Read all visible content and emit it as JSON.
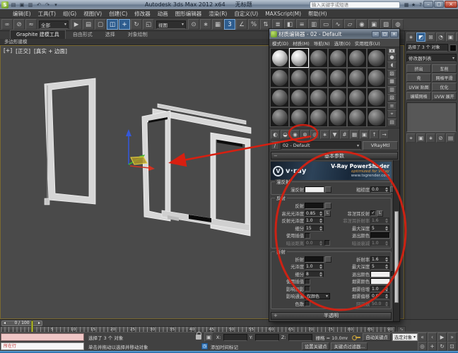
{
  "colors": {
    "annotation_red": "#d81f10",
    "vray_banner_blue": "#1e3146",
    "vray_orange": "#e29a3c",
    "toolbar_highlight_blue": "#2e5d8f",
    "active_viewport_yellow": "#7a6930",
    "diffuse_swatch": "#f0f0f0",
    "reflect_swatch": "#141414",
    "time_cursor_yellow": "#c9d435"
  },
  "titlebar": {
    "app_title": "Autodesk 3ds Max 2012 x64",
    "doc_title": "无标题",
    "search_placeholder": "输入关键字或短语",
    "window_controls": {
      "minimize": "–",
      "maximize": "▢",
      "close": "×"
    }
  },
  "menubar": {
    "items": [
      "编辑(E)",
      "工具(T)",
      "组(G)",
      "视图(V)",
      "创建(C)",
      "修改器",
      "动画",
      "图形编辑器",
      "渲染(R)",
      "自定义(U)",
      "MAXScript(M)",
      "帮助(H)"
    ]
  },
  "toolbar": {
    "icons": [
      {
        "name": "select-and-link-icon",
        "glyph": "∞"
      },
      {
        "name": "unlink-selection-icon",
        "glyph": "⊘"
      },
      {
        "name": "bind-to-space-warp-icon",
        "glyph": "≈"
      },
      {
        "name": "selection-filter-dropdown",
        "type": "dropdown",
        "label": "全部"
      },
      {
        "name": "select-object-icon",
        "glyph": "▶"
      },
      {
        "name": "select-by-name-icon",
        "glyph": "▤"
      },
      {
        "name": "rectangular-selection-region-icon",
        "glyph": "▢"
      },
      {
        "name": "window-crossing-icon",
        "glyph": "◫",
        "selected": true
      },
      {
        "name": "select-and-move-icon",
        "glyph": "+",
        "selected": true
      },
      {
        "name": "select-and-rotate-icon",
        "glyph": "↻"
      },
      {
        "name": "select-and-scale-icon",
        "glyph": "◱"
      },
      {
        "name": "reference-coordinate-dropdown",
        "type": "dropdown",
        "label": "视图"
      },
      {
        "name": "use-pivot-point-center-icon",
        "glyph": "⊙"
      },
      {
        "name": "select-and-manipulate-icon",
        "glyph": "∗"
      },
      {
        "name": "keyboard-shortcut-override-icon",
        "glyph": "▦"
      },
      {
        "name": "snaps-toggle-3d-icon",
        "glyph": "3",
        "selected": true
      },
      {
        "name": "angle-snap-icon",
        "glyph": "∠"
      },
      {
        "name": "percent-snap-icon",
        "glyph": "%"
      },
      {
        "name": "spinner-snap-icon",
        "glyph": "⇅"
      },
      {
        "name": "named-selection-sets-icon",
        "glyph": "≣"
      },
      {
        "name": "mirror-icon",
        "glyph": "◧"
      },
      {
        "name": "align-icon",
        "glyph": "≡"
      },
      {
        "name": "layer-manager-icon",
        "glyph": "▥"
      },
      {
        "name": "graphite-ribbon-toggle-icon",
        "glyph": "▭"
      },
      {
        "name": "curve-editor-icon",
        "glyph": "∿"
      },
      {
        "name": "schematic-view-icon",
        "glyph": "▱"
      },
      {
        "name": "material-editor-icon",
        "glyph": "◉"
      },
      {
        "name": "render-setup-icon",
        "glyph": "▣"
      },
      {
        "name": "rendered-frame-window-icon",
        "glyph": "▨"
      },
      {
        "name": "render-production-icon",
        "glyph": "◍"
      }
    ]
  },
  "ribbon": {
    "tabs": [
      {
        "label": "Graphite 建模工具",
        "active": true
      },
      {
        "label": "自由形式",
        "active": false
      },
      {
        "label": "选择",
        "active": false
      },
      {
        "label": "对象绘制",
        "active": false
      }
    ],
    "panel_label": "多边形建模"
  },
  "viewport": {
    "labels": [
      "[+]",
      "[正交]",
      "[真实 + 边面]"
    ]
  },
  "command_panel": {
    "tabs": [
      {
        "name": "create-tab-icon",
        "glyph": "∗"
      },
      {
        "name": "modify-tab-icon",
        "glyph": "◩",
        "selected": true
      },
      {
        "name": "hierarchy-tab-icon",
        "glyph": "⊞"
      },
      {
        "name": "motion-tab-icon",
        "glyph": "◔"
      },
      {
        "name": "display-tab-icon",
        "glyph": "▣"
      },
      {
        "name": "utilities-tab-icon",
        "glyph": "▦"
      }
    ],
    "selection_field": "选择了 3 个 对象",
    "modifier_list_label": "修改器列表",
    "modifier_buttons": [
      "挤出",
      "车削",
      "壳",
      "网格平滑",
      "UVW 贴图",
      "优化",
      "编辑网格",
      "UVW 展开"
    ],
    "stack_tool_icons": [
      {
        "name": "pin-stack-icon",
        "glyph": "⌖"
      },
      {
        "name": "show-end-result-icon",
        "glyph": "▣"
      },
      {
        "name": "make-unique-icon",
        "glyph": "∗"
      },
      {
        "name": "remove-modifier-icon",
        "glyph": "⊘"
      },
      {
        "name": "configure-modifier-sets-icon",
        "glyph": "▤"
      }
    ]
  },
  "material_editor": {
    "title": "材质编辑器 - 02 - Default",
    "menu_items": [
      "模式(D)",
      "材质(M)",
      "导航(N)",
      "选项(O)",
      "实用程序(U)"
    ],
    "slot_rows": 4,
    "slot_cols": 6,
    "light_slots": [
      0,
      1
    ],
    "active_slot": 1,
    "toolbar_icons": [
      {
        "name": "get-material-icon",
        "glyph": "◐"
      },
      {
        "name": "put-material-to-scene-icon",
        "glyph": "◒"
      },
      {
        "name": "assign-material-to-selection-icon",
        "glyph": "◉"
      },
      {
        "name": "reset-map-icon",
        "glyph": "⊗"
      },
      {
        "name": "make-material-copy-icon",
        "glyph": "◎"
      },
      {
        "name": "make-unique-icon",
        "glyph": "∗"
      },
      {
        "name": "put-to-library-icon",
        "glyph": "▼"
      },
      {
        "name": "material-id-channel-icon",
        "glyph": "#"
      },
      {
        "name": "show-map-in-viewport-icon",
        "glyph": "▦"
      },
      {
        "name": "show-end-result-icon",
        "glyph": "▣"
      },
      {
        "name": "go-to-parent-icon",
        "glyph": "↑"
      },
      {
        "name": "go-to-sibling-icon",
        "glyph": "→"
      }
    ],
    "side_icons": [
      {
        "name": "sample-type-icon",
        "glyph": "●"
      },
      {
        "name": "backlight-icon",
        "glyph": "◖"
      },
      {
        "name": "background-icon",
        "glyph": "▨"
      },
      {
        "name": "sample-uv-tiling-icon",
        "glyph": "▦"
      },
      {
        "name": "video-color-check-icon",
        "glyph": "▥"
      },
      {
        "name": "make-preview-icon",
        "glyph": "▧"
      },
      {
        "name": "options-icon",
        "glyph": "≡"
      },
      {
        "name": "select-by-material-icon",
        "glyph": "⌖"
      },
      {
        "name": "material-map-navigator-icon",
        "glyph": "▤"
      }
    ],
    "pick_material_label": "/",
    "material_name": "02 - Default",
    "material_type": "VRayMtl",
    "rollout_basic": "基本参数",
    "rollout_translucency": "半透明",
    "banner": {
      "logo_letter": "V",
      "logo_word": "v·ray",
      "title": "V-Ray PowerShader",
      "subtitle": "optimized for V-Ray",
      "url": "www.tsgrender.com"
    },
    "groups": [
      {
        "title": "漫反射",
        "rows": [
          {
            "ll": "漫反射",
            "lctl": "swatch-white",
            "lbtn": true,
            "rl": "粗糙度",
            "rv": "0.0",
            "rbtn": true
          }
        ]
      },
      {
        "title": "反射",
        "rows": [
          {
            "ll": "反射",
            "lctl": "swatch-dark",
            "lbtn": true
          },
          {
            "ll": "高光光泽度",
            "lv": "0.85",
            "lbtn2": "L",
            "rl": "菲涅耳反射",
            "rctl": "check-on",
            "rbtn2": "L"
          },
          {
            "ll": "反射光泽度",
            "lv": "1.0",
            "rl": "菲涅耳折射率",
            "rv": "1.6",
            "rdis": true
          },
          {
            "ll": "细分",
            "lv": "15",
            "rl": "最大深度",
            "rv": "5"
          },
          {
            "ll": "使用插值",
            "lctl": "check-off",
            "rl": "退出颜色",
            "rctl": "swatch-dark"
          },
          {
            "ll": "暗淡距离",
            "lv": "0.0",
            "ldis": true,
            "lchk": true,
            "rl": "暗淡衰减",
            "rv": "1.0",
            "rdis": true
          }
        ]
      },
      {
        "title": "折射",
        "rows": [
          {
            "ll": "折射",
            "lctl": "swatch-dark",
            "lbtn": true,
            "rl": "折射率",
            "rv": "1.6"
          },
          {
            "ll": "光泽度",
            "lv": "1.0",
            "rl": "最大深度",
            "rv": "5"
          },
          {
            "ll": "细分",
            "lv": "8",
            "rl": "退出颜色",
            "rctl": "swatch-white",
            "rchk": true
          },
          {
            "ll": "使用插值",
            "lctl": "check-off",
            "rl": "烟雾颜色",
            "rctl": "swatch-white"
          },
          {
            "ll": "影响阴影",
            "lctl": "check-off",
            "rl": "烟雾倍增",
            "rv": "1.0"
          },
          {
            "ll": "影响通道",
            "lctl": "dropdown",
            "lval": "仅颜色",
            "rl": "烟雾偏移",
            "rv": "0.0"
          },
          {
            "ll": "色散",
            "lctl": "check-off",
            "rl": "阿贝数",
            "rv": "50.0",
            "rdis": true
          }
        ]
      }
    ]
  },
  "timeline": {
    "frame_display": "0 / 100",
    "prev_glyph": "◂",
    "next_glyph": "▸",
    "tick_labels": [
      "5",
      "10",
      "15",
      "20",
      "25",
      "30",
      "35",
      "40",
      "45",
      "50",
      "55",
      "60",
      "65",
      "70",
      "75",
      "80",
      "85",
      "90"
    ]
  },
  "status_bar": {
    "selection_text": "选择了 3 个 对象",
    "prompt_text": "单击并拖动以选择并移动对象",
    "listener_text": "所在行",
    "coord_labels": [
      "X:",
      "Y:",
      "Z:"
    ],
    "grid_text": "栅格 = 10.0mm",
    "auto_key_label": "自动关键点",
    "set_key_label": "设置关键点",
    "selected_filter_value": "选定对象",
    "key_filters_label": "关键点过滤器...",
    "add_time_tag_label": "添加时间标记",
    "playback_icons": [
      {
        "name": "go-to-start-icon",
        "glyph": "«"
      },
      {
        "name": "previous-frame-icon",
        "glyph": "‹"
      },
      {
        "name": "play-animation-icon",
        "glyph": "▶"
      },
      {
        "name": "go-to-end-icon",
        "glyph": "»"
      }
    ],
    "nav_icons": [
      {
        "name": "zoom-icon",
        "glyph": "◎"
      },
      {
        "name": "pan-icon",
        "glyph": "+"
      },
      {
        "name": "orbit-icon",
        "glyph": "↻"
      },
      {
        "name": "maximize-viewport-toggle-icon",
        "glyph": "⊡"
      }
    ]
  }
}
